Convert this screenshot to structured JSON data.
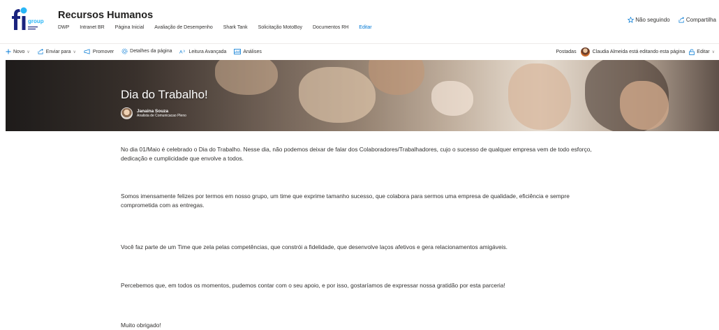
{
  "site": {
    "logo_text": "group",
    "title": "Recursos Humanos",
    "nav": [
      "DWP",
      "Intranet BR",
      "Página Inicial",
      "Avaliação de Desempenho",
      "Shark Tank",
      "Solicitação MotoBoy",
      "Documentos RH"
    ],
    "edit_label": "Editar"
  },
  "header_actions": {
    "follow_label": "Não seguindo",
    "share_label": "Compartilha"
  },
  "command_bar": {
    "new_label": "Novo",
    "send_label": "Enviar para",
    "promote_label": "Promover",
    "page_details_label": "Detalhes da página",
    "immersive_reader_label": "Leitura Avançada",
    "analytics_label": "Análises",
    "posted_label": "Postadas",
    "editing_status": "Claudia Almeida está editando esta página",
    "edit_label": "Editar"
  },
  "hero": {
    "title": "Dia do Trabalho!",
    "author_name": "Janaina Souza",
    "author_role": "Analista de Comunicacao Pleno"
  },
  "content": {
    "paragraphs": [
      "No dia 01/Maio é celebrado o Dia do Trabalho. Nesse dia, não podemos deixar de falar dos Colaboradores/Trabalhadores, cujo o sucesso de qualquer empresa vem de todo esforço, dedicação e cumplicidade que envolve a todos.",
      "Somos imensamente felizes por termos em nosso grupo, um time que exprime tamanho sucesso, que colabora para sermos uma empresa de qualidade, eficiência e sempre comprometida com as entregas.",
      "Você faz parte de um Time que zela pelas competências, que constrói a fidelidade, que desenvolve laços afetivos e gera relacionamentos amigáveis.",
      "Percebemos que, em todos os momentos, pudemos contar com o seu apoio, e por isso, gostaríamos de expressar nossa gratidão por esta parceria!",
      "Muito obrigado!"
    ]
  },
  "colors": {
    "accent": "#0078d4",
    "logo_blue": "#1a237e",
    "logo_cyan": "#29b6f6"
  }
}
